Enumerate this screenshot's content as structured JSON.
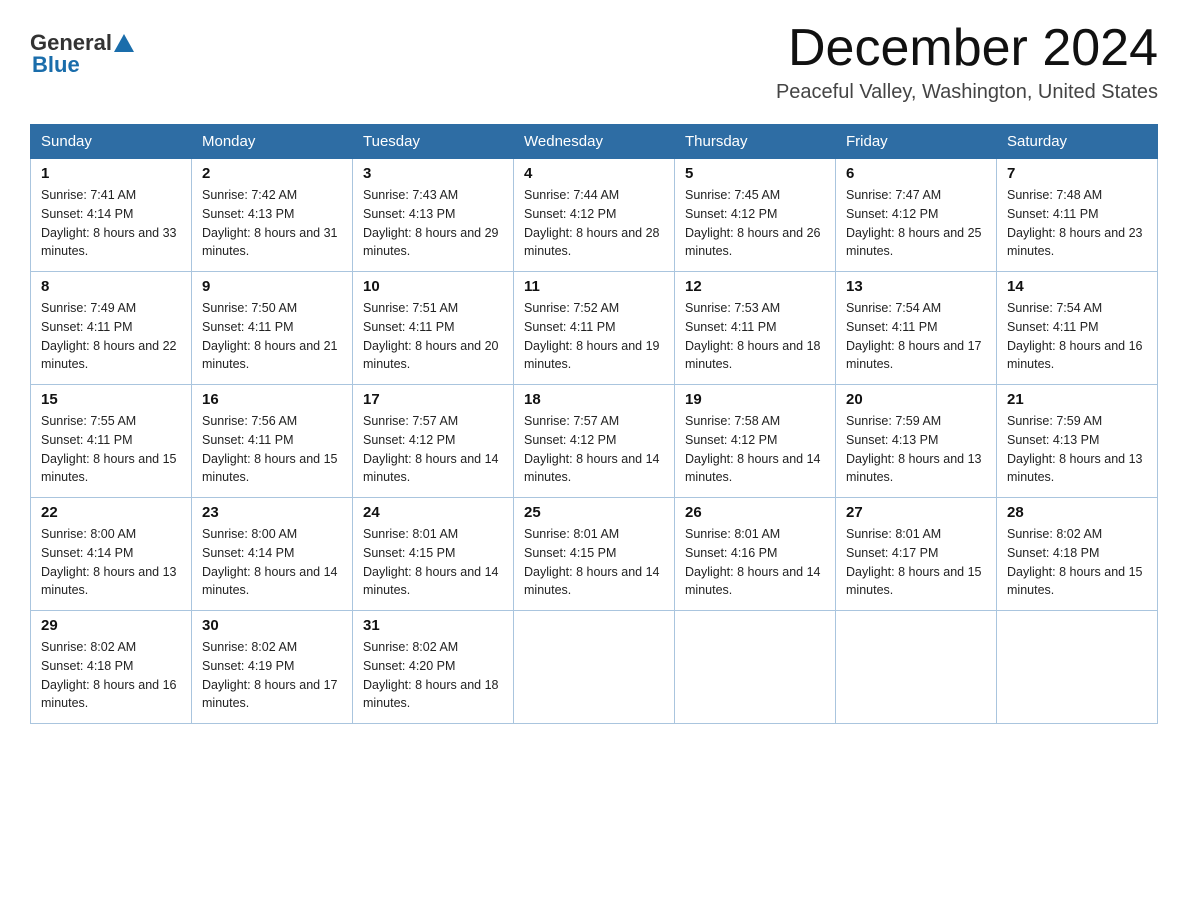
{
  "logo": {
    "general": "General",
    "blue": "Blue"
  },
  "title": "December 2024",
  "location": "Peaceful Valley, Washington, United States",
  "weekdays": [
    "Sunday",
    "Monday",
    "Tuesday",
    "Wednesday",
    "Thursday",
    "Friday",
    "Saturday"
  ],
  "weeks": [
    [
      {
        "day": "1",
        "sunrise": "7:41 AM",
        "sunset": "4:14 PM",
        "daylight": "8 hours and 33 minutes."
      },
      {
        "day": "2",
        "sunrise": "7:42 AM",
        "sunset": "4:13 PM",
        "daylight": "8 hours and 31 minutes."
      },
      {
        "day": "3",
        "sunrise": "7:43 AM",
        "sunset": "4:13 PM",
        "daylight": "8 hours and 29 minutes."
      },
      {
        "day": "4",
        "sunrise": "7:44 AM",
        "sunset": "4:12 PM",
        "daylight": "8 hours and 28 minutes."
      },
      {
        "day": "5",
        "sunrise": "7:45 AM",
        "sunset": "4:12 PM",
        "daylight": "8 hours and 26 minutes."
      },
      {
        "day": "6",
        "sunrise": "7:47 AM",
        "sunset": "4:12 PM",
        "daylight": "8 hours and 25 minutes."
      },
      {
        "day": "7",
        "sunrise": "7:48 AM",
        "sunset": "4:11 PM",
        "daylight": "8 hours and 23 minutes."
      }
    ],
    [
      {
        "day": "8",
        "sunrise": "7:49 AM",
        "sunset": "4:11 PM",
        "daylight": "8 hours and 22 minutes."
      },
      {
        "day": "9",
        "sunrise": "7:50 AM",
        "sunset": "4:11 PM",
        "daylight": "8 hours and 21 minutes."
      },
      {
        "day": "10",
        "sunrise": "7:51 AM",
        "sunset": "4:11 PM",
        "daylight": "8 hours and 20 minutes."
      },
      {
        "day": "11",
        "sunrise": "7:52 AM",
        "sunset": "4:11 PM",
        "daylight": "8 hours and 19 minutes."
      },
      {
        "day": "12",
        "sunrise": "7:53 AM",
        "sunset": "4:11 PM",
        "daylight": "8 hours and 18 minutes."
      },
      {
        "day": "13",
        "sunrise": "7:54 AM",
        "sunset": "4:11 PM",
        "daylight": "8 hours and 17 minutes."
      },
      {
        "day": "14",
        "sunrise": "7:54 AM",
        "sunset": "4:11 PM",
        "daylight": "8 hours and 16 minutes."
      }
    ],
    [
      {
        "day": "15",
        "sunrise": "7:55 AM",
        "sunset": "4:11 PM",
        "daylight": "8 hours and 15 minutes."
      },
      {
        "day": "16",
        "sunrise": "7:56 AM",
        "sunset": "4:11 PM",
        "daylight": "8 hours and 15 minutes."
      },
      {
        "day": "17",
        "sunrise": "7:57 AM",
        "sunset": "4:12 PM",
        "daylight": "8 hours and 14 minutes."
      },
      {
        "day": "18",
        "sunrise": "7:57 AM",
        "sunset": "4:12 PM",
        "daylight": "8 hours and 14 minutes."
      },
      {
        "day": "19",
        "sunrise": "7:58 AM",
        "sunset": "4:12 PM",
        "daylight": "8 hours and 14 minutes."
      },
      {
        "day": "20",
        "sunrise": "7:59 AM",
        "sunset": "4:13 PM",
        "daylight": "8 hours and 13 minutes."
      },
      {
        "day": "21",
        "sunrise": "7:59 AM",
        "sunset": "4:13 PM",
        "daylight": "8 hours and 13 minutes."
      }
    ],
    [
      {
        "day": "22",
        "sunrise": "8:00 AM",
        "sunset": "4:14 PM",
        "daylight": "8 hours and 13 minutes."
      },
      {
        "day": "23",
        "sunrise": "8:00 AM",
        "sunset": "4:14 PM",
        "daylight": "8 hours and 14 minutes."
      },
      {
        "day": "24",
        "sunrise": "8:01 AM",
        "sunset": "4:15 PM",
        "daylight": "8 hours and 14 minutes."
      },
      {
        "day": "25",
        "sunrise": "8:01 AM",
        "sunset": "4:15 PM",
        "daylight": "8 hours and 14 minutes."
      },
      {
        "day": "26",
        "sunrise": "8:01 AM",
        "sunset": "4:16 PM",
        "daylight": "8 hours and 14 minutes."
      },
      {
        "day": "27",
        "sunrise": "8:01 AM",
        "sunset": "4:17 PM",
        "daylight": "8 hours and 15 minutes."
      },
      {
        "day": "28",
        "sunrise": "8:02 AM",
        "sunset": "4:18 PM",
        "daylight": "8 hours and 15 minutes."
      }
    ],
    [
      {
        "day": "29",
        "sunrise": "8:02 AM",
        "sunset": "4:18 PM",
        "daylight": "8 hours and 16 minutes."
      },
      {
        "day": "30",
        "sunrise": "8:02 AM",
        "sunset": "4:19 PM",
        "daylight": "8 hours and 17 minutes."
      },
      {
        "day": "31",
        "sunrise": "8:02 AM",
        "sunset": "4:20 PM",
        "daylight": "8 hours and 18 minutes."
      },
      null,
      null,
      null,
      null
    ]
  ]
}
